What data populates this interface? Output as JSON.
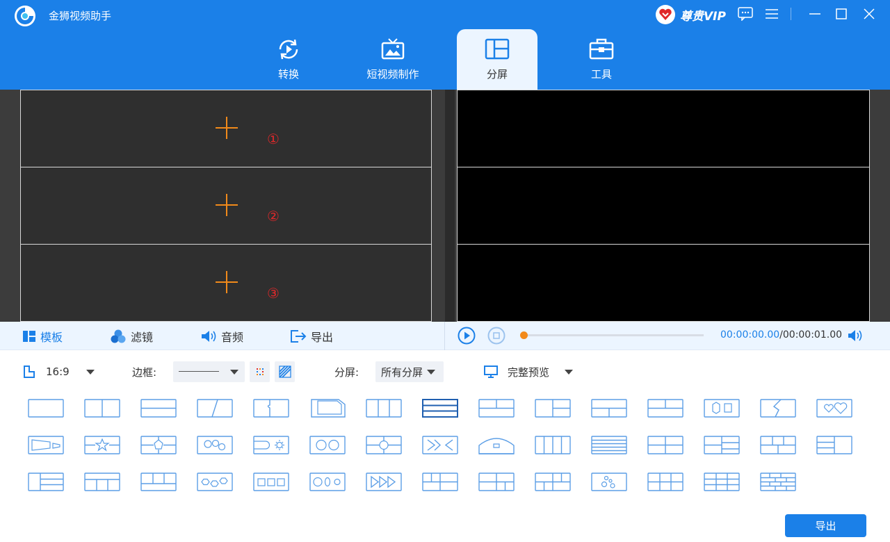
{
  "app": {
    "title": "金狮视频助手",
    "vip_label": "尊贵VIP"
  },
  "colors": {
    "brand": "#1b80e8",
    "accent": "#f28a1a",
    "number": "#e0282a"
  },
  "tabs": [
    {
      "label": "转换",
      "icon": "convert-icon"
    },
    {
      "label": "短视频制作",
      "icon": "tv-icon"
    },
    {
      "label": "分屏",
      "icon": "split-screen-icon",
      "active": true
    },
    {
      "label": "工具",
      "icon": "toolbox-icon"
    }
  ],
  "editor": {
    "cells": [
      {
        "number": "①"
      },
      {
        "number": "②"
      },
      {
        "number": "③"
      }
    ]
  },
  "strip": {
    "template": "模板",
    "filter": "滤镜",
    "audio": "音频",
    "export": "导出"
  },
  "player": {
    "current_time": "00:00:00.00",
    "total_time": "/00:00:01.00",
    "progress": 0
  },
  "options": {
    "ratio": "16:9",
    "border_label": "边框:",
    "split_label": "分屏:",
    "split_value": "所有分屏",
    "preview_value": "完整预览"
  },
  "export_button": "导出"
}
